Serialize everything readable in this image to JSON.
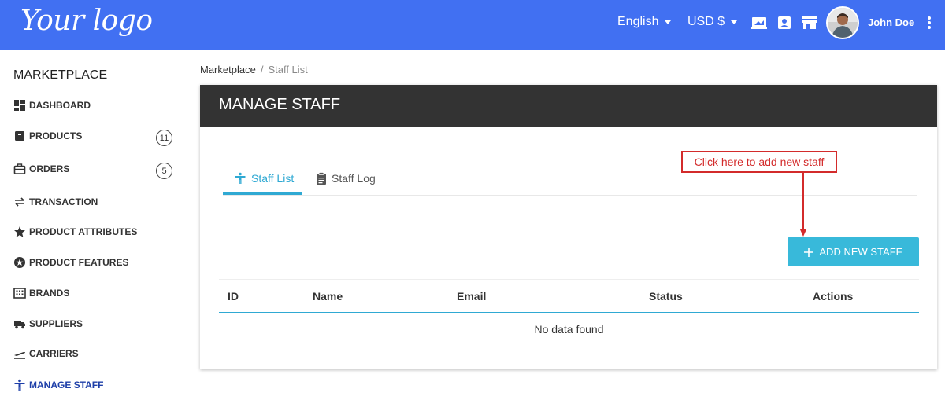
{
  "header": {
    "logo_text": "Your logo",
    "language": "English",
    "currency": "USD $",
    "user_name": "John Doe",
    "icons": [
      "laptop-icon",
      "contact-card-icon",
      "store-icon",
      "more-vert-icon"
    ]
  },
  "sidebar": {
    "title": "MARKETPLACE",
    "items": [
      {
        "label": "DASHBOARD",
        "icon": "dashboard-icon"
      },
      {
        "label": "PRODUCTS",
        "icon": "box-icon",
        "count": "11"
      },
      {
        "label": "ORDERS",
        "icon": "briefcase-icon",
        "count": "5"
      },
      {
        "label": "TRANSACTION",
        "icon": "swap-icon"
      },
      {
        "label": "PRODUCT ATTRIBUTES",
        "icon": "star-half-icon"
      },
      {
        "label": "PRODUCT FEATURES",
        "icon": "star-circle-icon"
      },
      {
        "label": "BRANDS",
        "icon": "building-icon"
      },
      {
        "label": "SUPPLIERS",
        "icon": "truck-icon"
      },
      {
        "label": "CARRIERS",
        "icon": "flight-icon"
      },
      {
        "label": "MANAGE STAFF",
        "icon": "person-icon",
        "active": true
      }
    ]
  },
  "breadcrumb": {
    "root": "Marketplace",
    "separator": "/",
    "current": "Staff List"
  },
  "page": {
    "title": "MANAGE STAFF",
    "tabs": [
      {
        "label": "Staff List",
        "active": true
      },
      {
        "label": "Staff Log",
        "active": false
      }
    ],
    "callout": "Click here to add new staff",
    "add_button": "ADD NEW STAFF",
    "table": {
      "columns": [
        "ID",
        "Name",
        "Email",
        "Status",
        "Actions"
      ],
      "empty_message": "No data found"
    }
  },
  "colors": {
    "header_bg": "#4170f2",
    "card_header_bg": "#333333",
    "accent": "#2fa9d3",
    "button_bg": "#38b9da",
    "callout": "#d32b2b",
    "active_nav": "#1e3fa8"
  }
}
